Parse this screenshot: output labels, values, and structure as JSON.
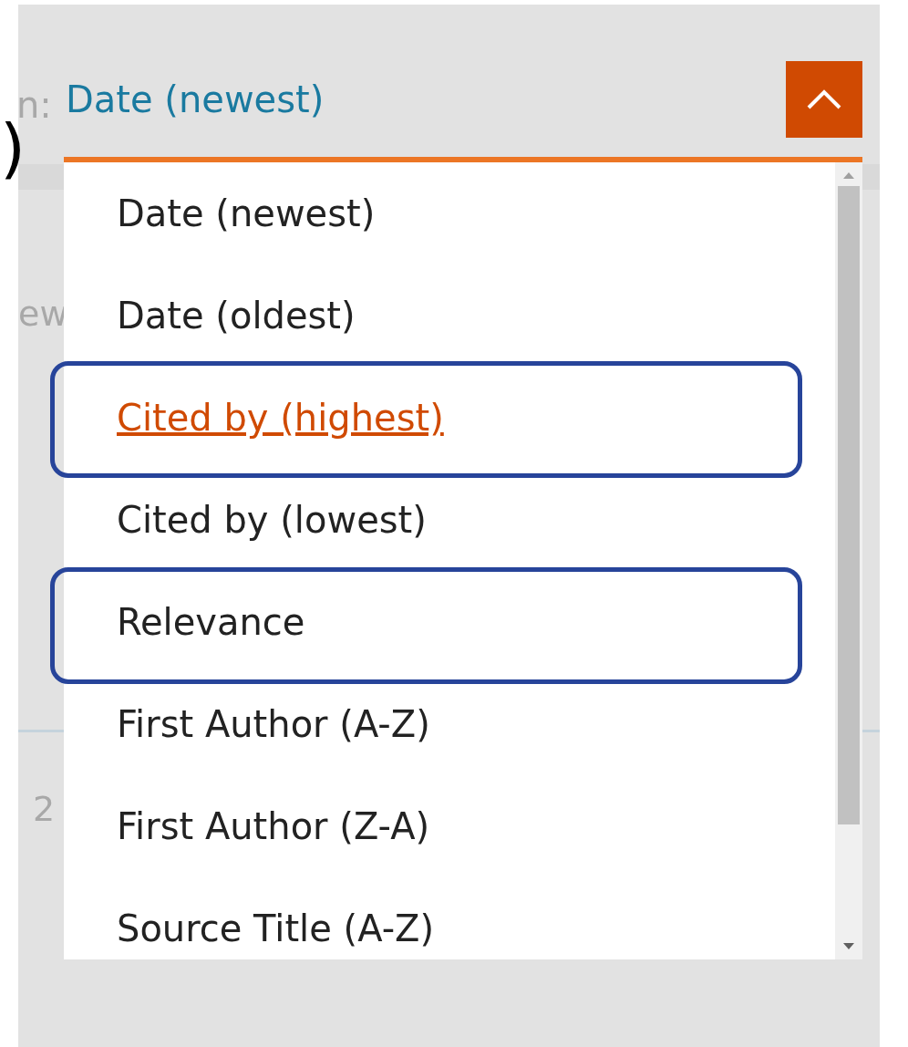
{
  "background_fragments": [
    {
      "text": "n:",
      "kind": "label"
    },
    {
      "text": ")",
      "kind": "mark"
    },
    {
      "text": "ew",
      "kind": "faded"
    },
    {
      "text": "2",
      "kind": "faded"
    }
  ],
  "sort_dropdown": {
    "value": "Date (newest)",
    "expanded": true,
    "options": [
      {
        "label": "Date (newest)",
        "hovered": false,
        "annotated": false
      },
      {
        "label": "Date (oldest)",
        "hovered": false,
        "annotated": false
      },
      {
        "label": "Cited by (highest)",
        "hovered": true,
        "annotated": true
      },
      {
        "label": "Cited by (lowest)",
        "hovered": false,
        "annotated": false
      },
      {
        "label": "Relevance",
        "hovered": false,
        "annotated": true
      },
      {
        "label": "First Author (A-Z)",
        "hovered": false,
        "annotated": false
      },
      {
        "label": "First Author (Z-A)",
        "hovered": false,
        "annotated": false
      },
      {
        "label": "Source Title (A-Z)",
        "hovered": false,
        "annotated": false
      }
    ]
  }
}
